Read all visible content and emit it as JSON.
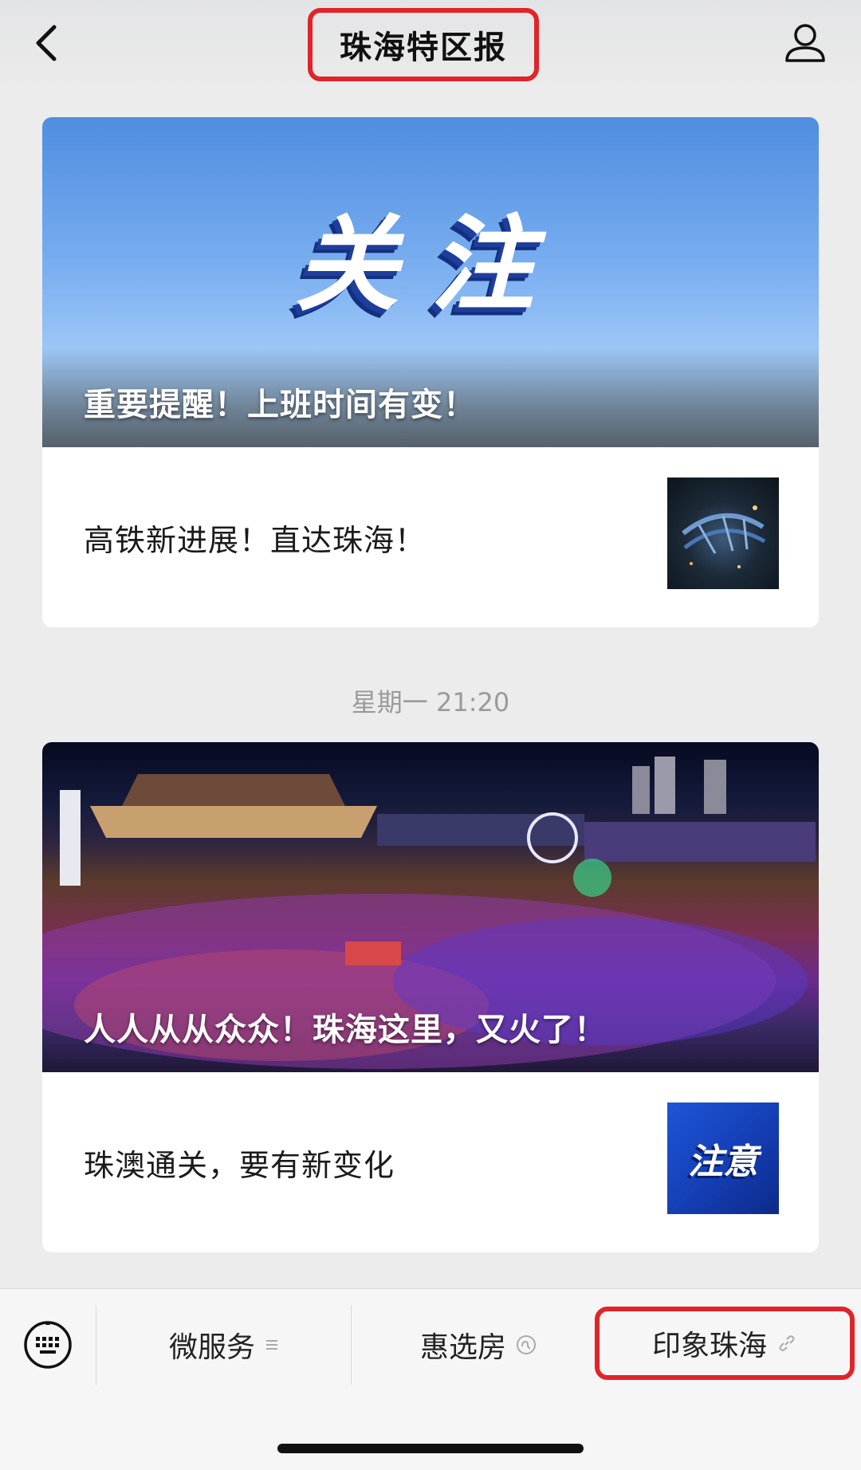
{
  "header": {
    "title": "珠海特区报"
  },
  "feed": {
    "card1": {
      "hero_title": "关注",
      "hero_caption": "重要提醒！上班时间有变！",
      "item_text": "高铁新进展！直达珠海！"
    },
    "timestamp": "星期一 21:20",
    "card2": {
      "hero_caption": "人人从从众众！珠海这里，又火了！",
      "item_text": "珠澳通关，要有新变化",
      "thumb_text": "注意"
    }
  },
  "bottom_menu": {
    "items": [
      {
        "label": "微服务",
        "icon": "menu-list-icon"
      },
      {
        "label": "惠选房",
        "icon": "mini-program-icon"
      },
      {
        "label": "印象珠海",
        "icon": "link-icon"
      }
    ]
  },
  "colors": {
    "highlight": "#e0242a",
    "accent_blue": "#1e56d8"
  }
}
